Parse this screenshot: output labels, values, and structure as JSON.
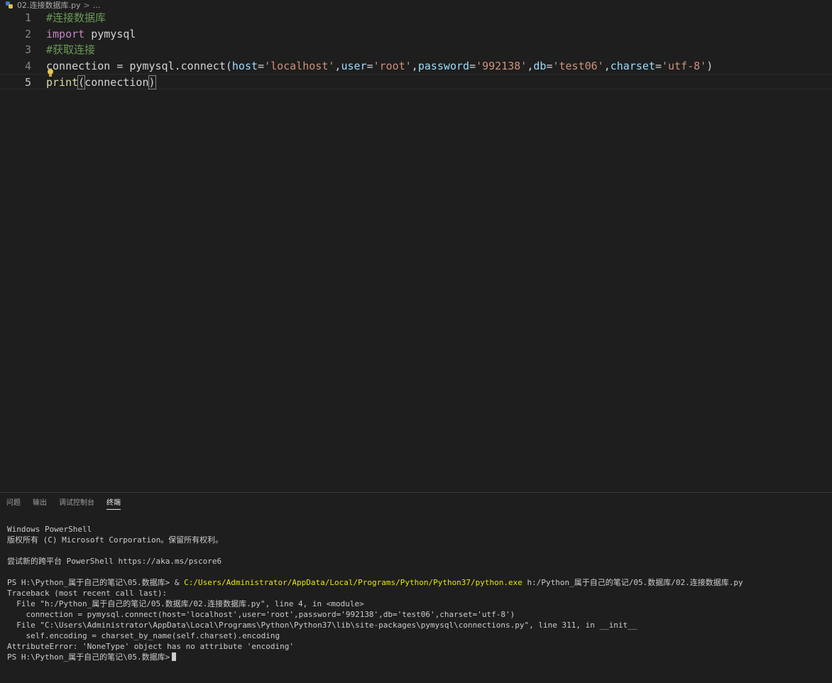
{
  "breadcrumb": {
    "file": "02.连接数据库.py",
    "separator": ">",
    "more": "..."
  },
  "editor": {
    "lines": [
      {
        "number": "1",
        "comment": "#连接数据库"
      },
      {
        "number": "2",
        "keyword": "import",
        "module": " pymysql"
      },
      {
        "number": "3",
        "comment": "#获取连接"
      },
      {
        "number": "4",
        "var": "connection",
        "eq": " = ",
        "obj": "pymysql",
        "dot": ".",
        "fn": "connect",
        "open": "(",
        "p1": "host",
        "v1": "'localhost'",
        "p2": "user",
        "v2": "'root'",
        "p3": "password",
        "v3": "'992138'",
        "p4": "db",
        "v4": "'test06'",
        "p5": "charset",
        "v5": "'utf-8'",
        "assign": "=",
        "comma": ",",
        "close": ")"
      },
      {
        "number": "5",
        "fn": "print",
        "open": "(",
        "arg": "connection",
        "close": ")"
      }
    ]
  },
  "panel": {
    "tabs": [
      "问题",
      "输出",
      "调试控制台",
      "终端"
    ],
    "active_tab": "终端",
    "terminal": {
      "l1": "Windows PowerShell",
      "l2": "版权所有 (C) Microsoft Corporation。保留所有权利。",
      "l3": "尝试新的跨平台 PowerShell https://aka.ms/pscore6",
      "prompt": "PS H:\\Python_属于自己的笔记\\05.数据库> ",
      "cmd_amp": "& ",
      "cmd_exe": "C:/Users/Administrator/AppData/Local/Programs/Python/Python37/python.exe",
      "cmd_arg": " h:/Python_属于自己的笔记/05.数据库/02.连接数据库.py",
      "t1": "Traceback (most recent call last):",
      "t2": "  File \"h:/Python_属于自己的笔记/05.数据库/02.连接数据库.py\", line 4, in <module>",
      "t3": "    connection = pymysql.connect(host='localhost',user='root',password='992138',db='test06',charset='utf-8')",
      "t4": "  File \"C:\\Users\\Administrator\\AppData\\Local\\Programs\\Python\\Python37\\lib\\site-packages\\pymysql\\connections.py\", line 311, in __init__",
      "t5": "    self.encoding = charset_by_name(self.charset).encoding",
      "t6": "AttributeError: 'NoneType' object has no attribute 'encoding'",
      "final_prompt": "PS H:\\Python_属于自己的笔记\\05.数据库>"
    }
  },
  "colors": {
    "background": "#1e1e1e",
    "comment": "#6a9955",
    "keyword": "#c586c0",
    "string": "#ce9178",
    "param": "#9cdcfe",
    "function": "#dcdcaa",
    "terminal_exe": "#e5e510"
  }
}
